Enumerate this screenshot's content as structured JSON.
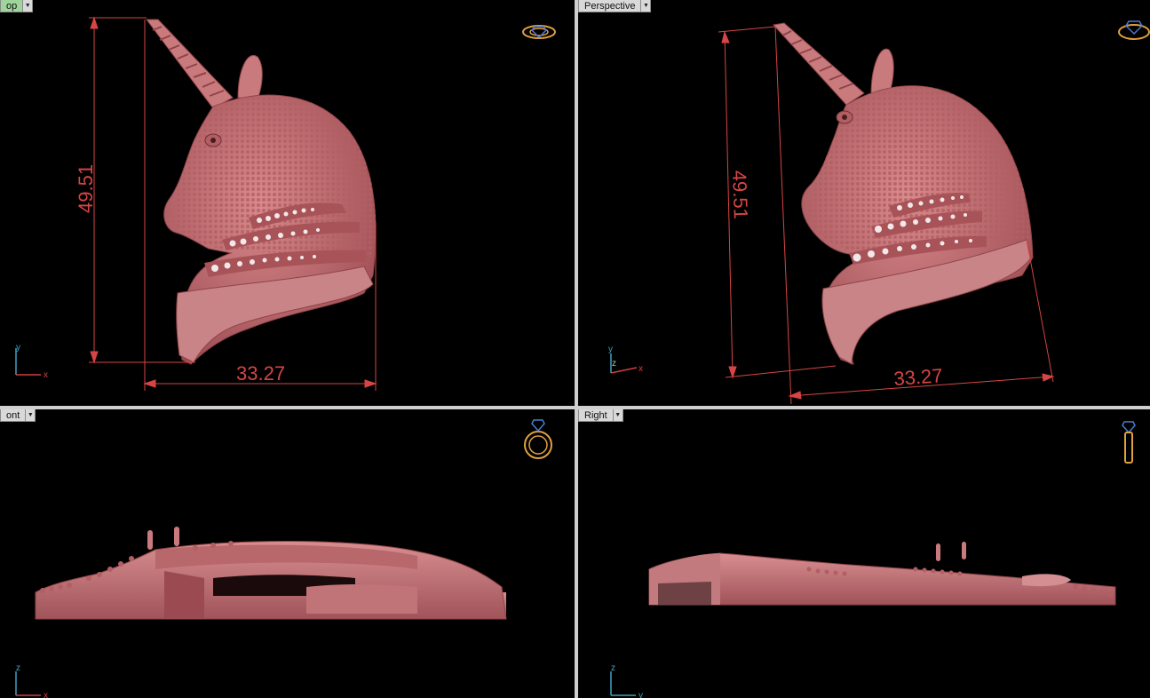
{
  "viewports": {
    "top": {
      "tab_label": "op",
      "active": true,
      "dim_height": "49.51",
      "dim_width": "33.27",
      "axis_v": "y",
      "axis_h": "x"
    },
    "perspective": {
      "tab_label": "Perspective",
      "active": false,
      "dim_height": "49.51",
      "dim_width": "33.27",
      "axis_v": "y",
      "axis_z": "z",
      "axis_h": "x"
    },
    "front": {
      "tab_label": "ont",
      "active": false,
      "axis_v": "z",
      "axis_h": "x"
    },
    "right": {
      "tab_label": "Right",
      "active": false,
      "axis_v": "z",
      "axis_h": "y"
    }
  },
  "colors": {
    "background": "#000000",
    "model": "#c06a6e",
    "dimension": "#d64545",
    "active_tab": "#9fd59b",
    "tab": "#d9d9d9",
    "axis_x": "#d04040",
    "axis_y": "#40a0c0",
    "widget_gold": "#e0a040",
    "widget_blue": "#4a7ad0"
  },
  "icons": {
    "top": "ring-top-view-icon",
    "perspective": "ring-perspective-icon",
    "front": "ring-front-view-icon",
    "right": "ring-side-view-icon"
  }
}
